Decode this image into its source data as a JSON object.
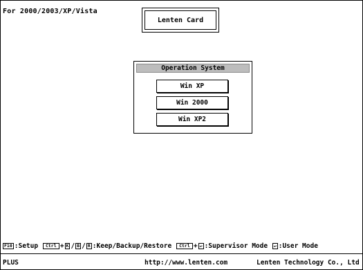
{
  "os_label": "For 2000/2003/XP/Vista",
  "title": "Lenten Card",
  "dialog": {
    "title": "Operation System",
    "options": [
      "Win XP",
      "Win 2000",
      "Win XP2"
    ]
  },
  "hotkeys": {
    "f10_key": "F10",
    "setup_text": ":Setup",
    "ctrl_key": "Ctrl",
    "k_key": "K",
    "b_key": "B",
    "r_key": "R",
    "keep_text": ":Keep/Backup/Restore",
    "enter_key": "↵",
    "supervisor_text": ":Supervisor Mode",
    "user_text": ":User Mode"
  },
  "status": {
    "left": "PLUS",
    "url": "http://www.lenten.com",
    "company": "Lenten Technology Co., Ltd"
  }
}
